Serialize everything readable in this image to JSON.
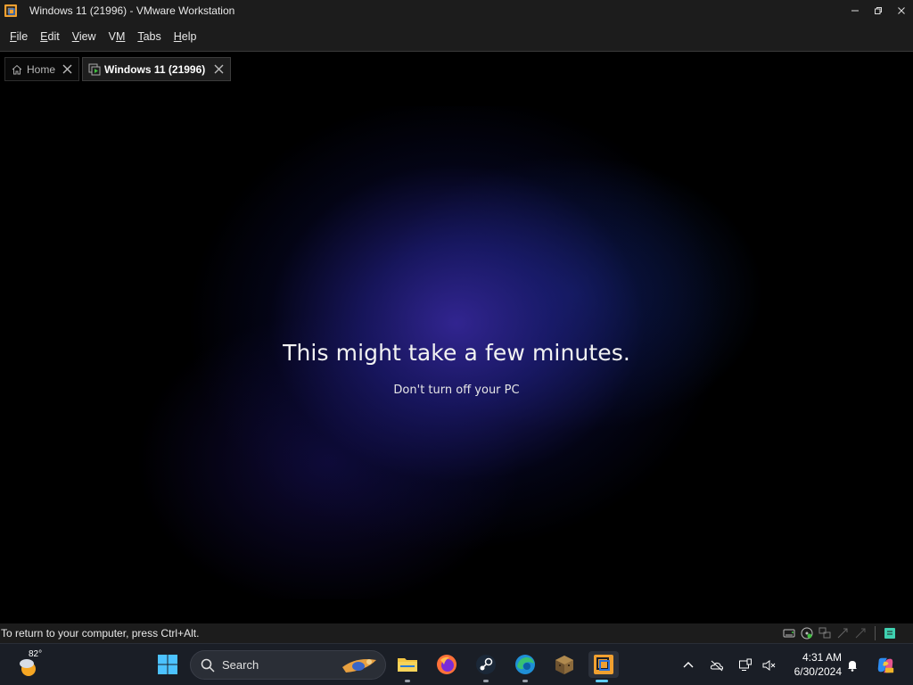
{
  "window": {
    "title": "Windows 11 (21996) - VMware Workstation"
  },
  "menu": {
    "file": {
      "mnemonic": "F",
      "rest": "ile"
    },
    "edit": {
      "mnemonic": "E",
      "rest": "dit"
    },
    "view": {
      "mnemonic": "V",
      "rest": "iew"
    },
    "vm": {
      "mnemonic": "M",
      "pre": "V"
    },
    "tabs": {
      "mnemonic": "T",
      "rest": "abs"
    },
    "help": {
      "mnemonic": "H",
      "rest": "elp"
    }
  },
  "tabs": [
    {
      "label": "Home",
      "active": false
    },
    {
      "label": "Windows 11 (21996)",
      "active": true
    }
  ],
  "guest": {
    "heading": "This might take a few minutes.",
    "subtext": "Don't turn off your PC"
  },
  "status": {
    "message": "To return to your computer, press Ctrl+Alt."
  },
  "taskbar": {
    "weather_temp": "82°",
    "search_placeholder": "Search",
    "pinned": [
      "windows-start",
      "file-explorer",
      "firefox",
      "steam",
      "edge",
      "minecraft",
      "vmware-workstation"
    ],
    "active_app": "vmware-workstation",
    "clock_time": "4:31 AM",
    "clock_date": "6/30/2024"
  },
  "colors": {
    "chrome_bg": "#1c1c1c",
    "taskbar_bg": "#1a1e26",
    "accent": "#60cdff",
    "guest_glow": "#3426a0"
  }
}
